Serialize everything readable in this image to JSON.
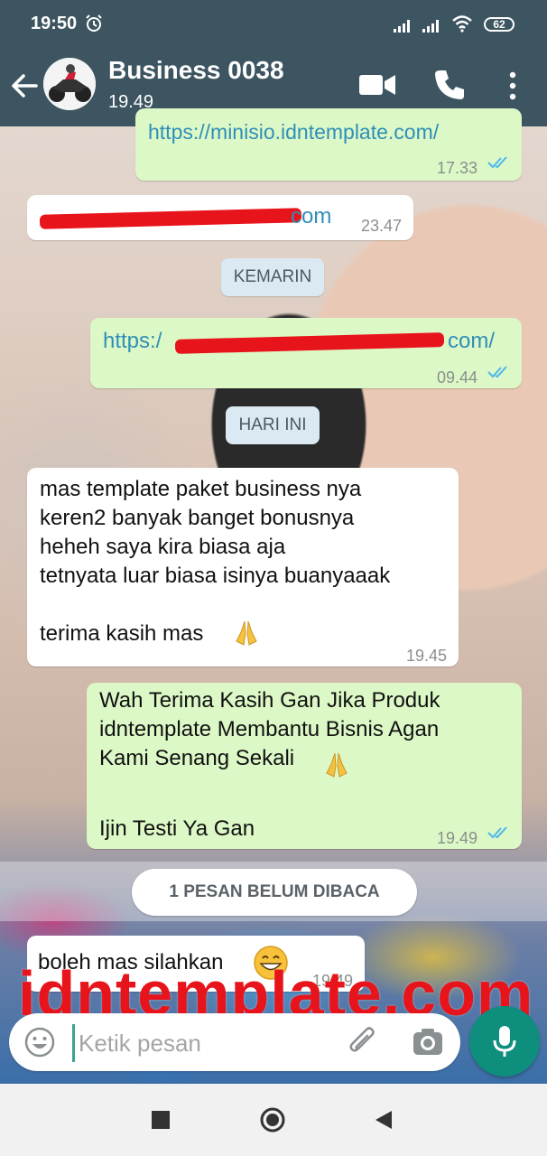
{
  "status_bar": {
    "time": "19:50",
    "battery": "62"
  },
  "header": {
    "contact_name": "Business 0038",
    "status": "19.49"
  },
  "messages": [
    {
      "type": "out",
      "text": "https://minisio.idntemplate.com/",
      "time": "17.33"
    },
    {
      "type": "in",
      "text_suffix": "com",
      "time": "23.47"
    },
    {
      "type": "out",
      "text_prefix": "https:/",
      "text_suffix": "com/",
      "time": "09.44"
    },
    {
      "type": "in",
      "text": "mas template paket business nya\nkeren2 banyak banget bonusnya\nheheh saya kira biasa aja\ntetnyata luar biasa isinya buanyaaak\n\nterima kasih mas",
      "time": "19.45"
    },
    {
      "type": "out",
      "text": "Wah Terima Kasih Gan Jika Produk\nidntemplate Membantu Bisnis Agan\nKami Senang Sekali",
      "text_after": "Ijin Testi Ya Gan",
      "time": "19.49"
    },
    {
      "type": "in",
      "text": "boleh mas silahkan",
      "time": "19.49"
    }
  ],
  "date_chips": {
    "yesterday": "KEMARIN",
    "today": "HARI INI"
  },
  "unread_label": "1 PESAN BELUM DIBACA",
  "watermark": "idntemplate.com",
  "composer": {
    "placeholder": "Ketik pesan"
  },
  "colors": {
    "header": "#3d5560",
    "outgoing": "#dcf8c6",
    "incoming": "#ffffff",
    "accent": "#0e8f7e",
    "ticks": "#4fb6ec"
  },
  "icons": [
    "back-arrow-icon",
    "video-call-icon",
    "phone-icon",
    "more-vert-icon",
    "emoji-icon",
    "attach-icon",
    "camera-icon",
    "mic-icon"
  ]
}
